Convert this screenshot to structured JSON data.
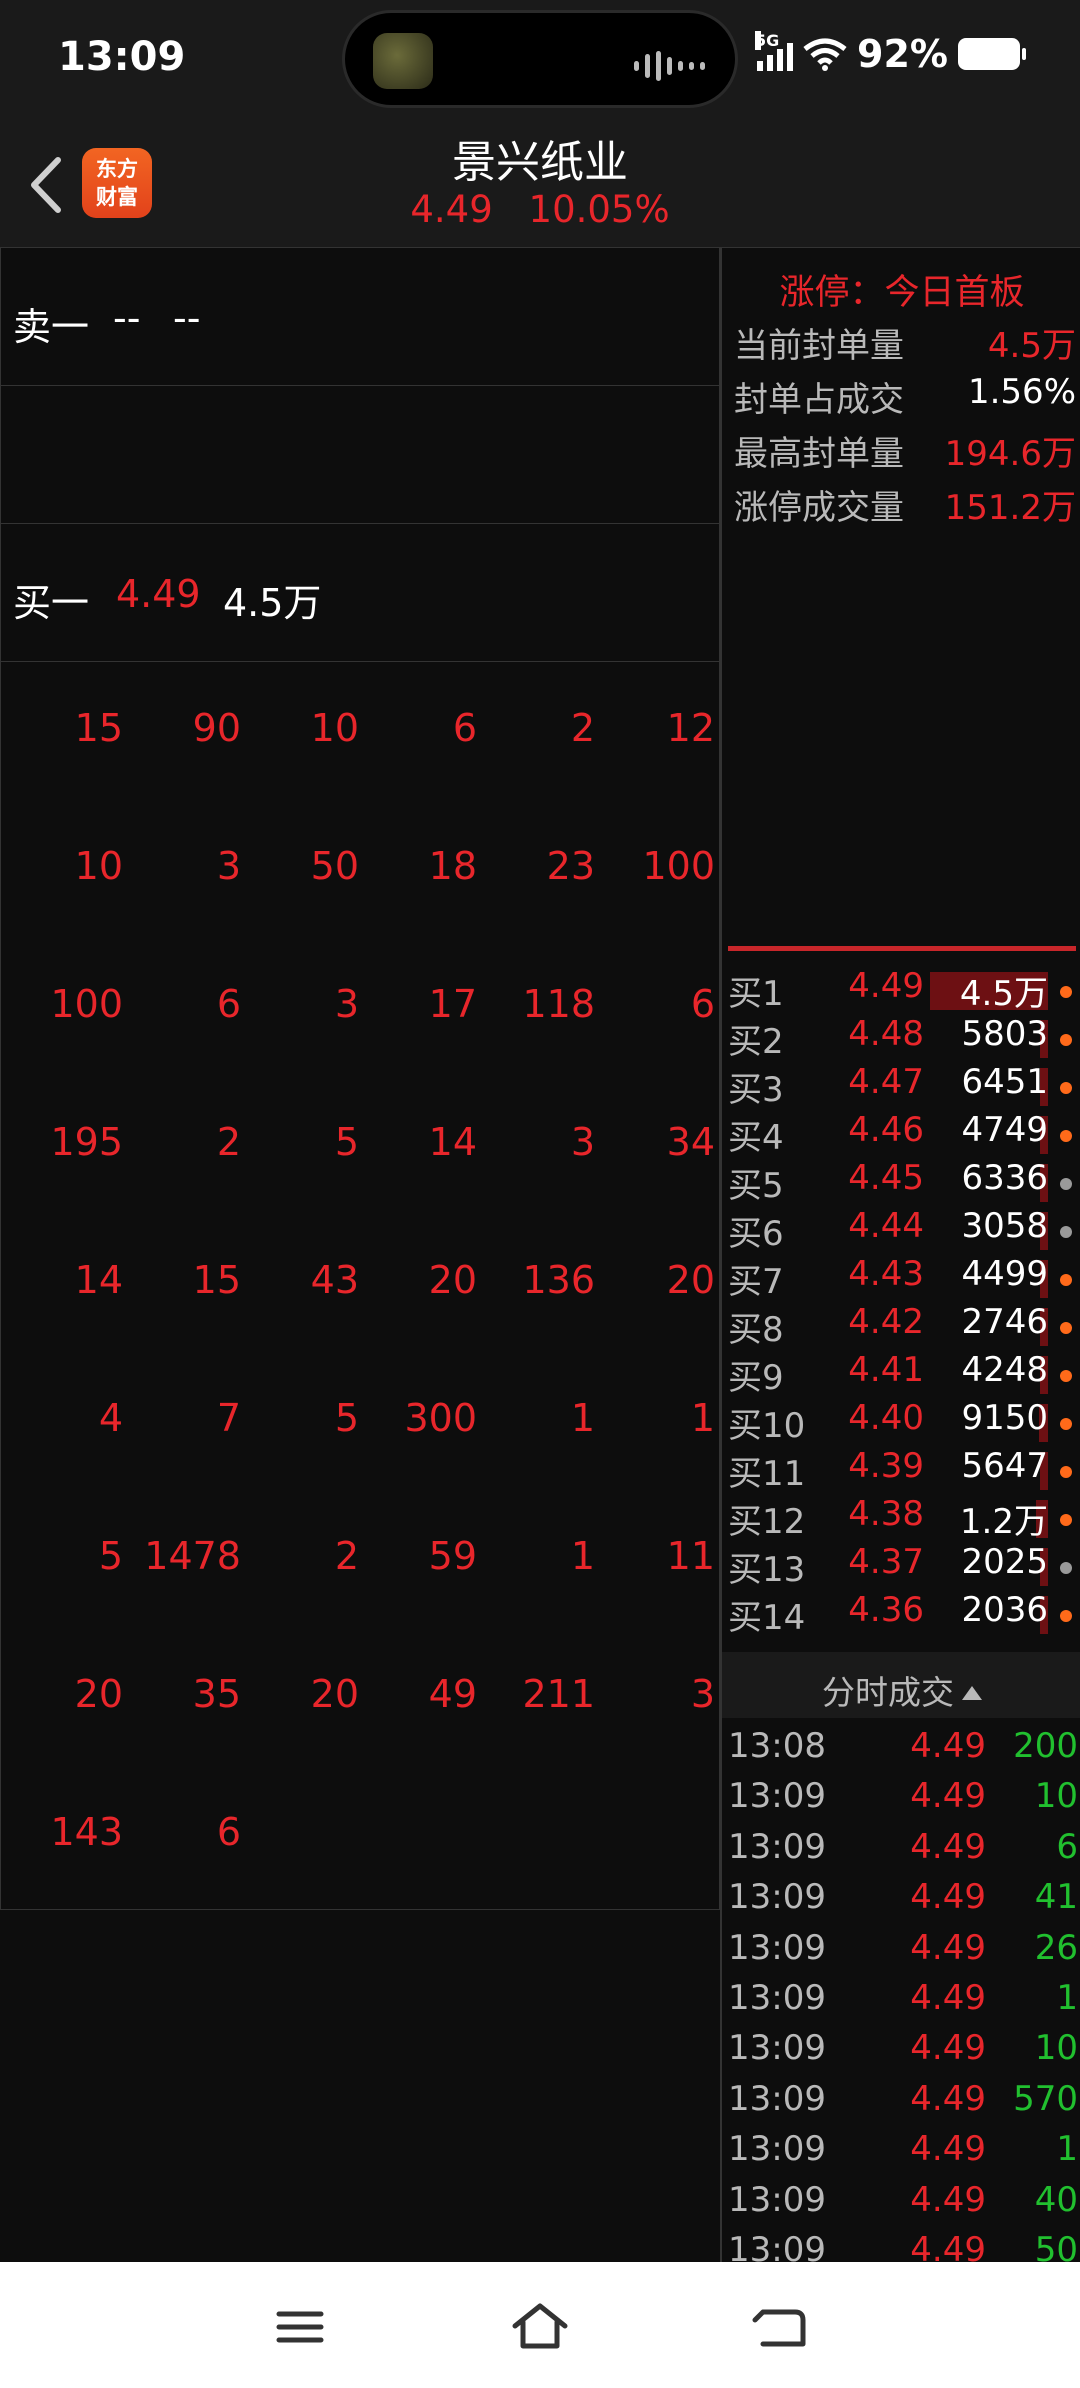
{
  "status_bar": {
    "time": "13:09",
    "network": "5G",
    "battery": "92%"
  },
  "header": {
    "stock_name": "景兴纸业",
    "price": "4.49",
    "change_pct": "10.05%",
    "logo_text_line1": "东方",
    "logo_text_line2": "财富"
  },
  "order_book": {
    "sell": {
      "label": "卖一",
      "price": "--",
      "volume": "--"
    },
    "buy": {
      "label": "买一",
      "price": "4.49",
      "volume": "4.5万"
    }
  },
  "order_grid": [
    [
      "15",
      "90",
      "10",
      "6",
      "2",
      "12"
    ],
    [
      "10",
      "3",
      "50",
      "18",
      "23",
      "100"
    ],
    [
      "100",
      "6",
      "3",
      "17",
      "118",
      "6"
    ],
    [
      "195",
      "2",
      "5",
      "14",
      "3",
      "34"
    ],
    [
      "14",
      "15",
      "43",
      "20",
      "136",
      "20"
    ],
    [
      "4",
      "7",
      "5",
      "300",
      "1",
      "1"
    ],
    [
      "5",
      "1478",
      "2",
      "59",
      "1",
      "11"
    ],
    [
      "20",
      "35",
      "20",
      "49",
      "211",
      "3"
    ],
    [
      "143",
      "6"
    ]
  ],
  "limit_info": {
    "title": "涨停：今日首板",
    "stats": [
      {
        "label": "当前封单量",
        "value": "4.5万",
        "color": "#e8262b"
      },
      {
        "label": "封单占成交",
        "value": "1.56%",
        "color": "#ffffff"
      },
      {
        "label": "最高封单量",
        "value": "194.6万",
        "color": "#e8262b"
      },
      {
        "label": "涨停成交量",
        "value": "151.2万",
        "color": "#e8262b"
      }
    ]
  },
  "buy_queue": [
    {
      "label": "买1",
      "price": "4.49",
      "volume": "4.5万",
      "bar": 1.0,
      "dot": "orange"
    },
    {
      "label": "买2",
      "price": "4.48",
      "volume": "5803",
      "bar": 0.05,
      "dot": "orange"
    },
    {
      "label": "买3",
      "price": "4.47",
      "volume": "6451",
      "bar": 0.06,
      "dot": "orange"
    },
    {
      "label": "买4",
      "price": "4.46",
      "volume": "4749",
      "bar": 0.04,
      "dot": "orange"
    },
    {
      "label": "买5",
      "price": "4.45",
      "volume": "6336",
      "bar": 0.06,
      "dot": "gray"
    },
    {
      "label": "买6",
      "price": "4.44",
      "volume": "3058",
      "bar": 0.03,
      "dot": "gray"
    },
    {
      "label": "买7",
      "price": "4.43",
      "volume": "4499",
      "bar": 0.04,
      "dot": "orange"
    },
    {
      "label": "买8",
      "price": "4.42",
      "volume": "2746",
      "bar": 0.03,
      "dot": "orange"
    },
    {
      "label": "买9",
      "price": "4.41",
      "volume": "4248",
      "bar": 0.04,
      "dot": "orange"
    },
    {
      "label": "买10",
      "price": "4.40",
      "volume": "9150",
      "bar": 0.08,
      "dot": "orange"
    },
    {
      "label": "买11",
      "price": "4.39",
      "volume": "5647",
      "bar": 0.05,
      "dot": "orange"
    },
    {
      "label": "买12",
      "price": "4.38",
      "volume": "1.2万",
      "bar": 0.1,
      "dot": "orange"
    },
    {
      "label": "买13",
      "price": "4.37",
      "volume": "2025",
      "bar": 0.02,
      "dot": "gray"
    },
    {
      "label": "买14",
      "price": "4.36",
      "volume": "2036",
      "bar": 0.02,
      "dot": "orange"
    }
  ],
  "ticks": {
    "header": "分时成交",
    "rows": [
      {
        "time": "13:08",
        "price": "4.49",
        "volume": "200"
      },
      {
        "time": "13:09",
        "price": "4.49",
        "volume": "10"
      },
      {
        "time": "13:09",
        "price": "4.49",
        "volume": "6"
      },
      {
        "time": "13:09",
        "price": "4.49",
        "volume": "41"
      },
      {
        "time": "13:09",
        "price": "4.49",
        "volume": "26"
      },
      {
        "time": "13:09",
        "price": "4.49",
        "volume": "1"
      },
      {
        "time": "13:09",
        "price": "4.49",
        "volume": "10"
      },
      {
        "time": "13:09",
        "price": "4.49",
        "volume": "570"
      },
      {
        "time": "13:09",
        "price": "4.49",
        "volume": "1"
      },
      {
        "time": "13:09",
        "price": "4.49",
        "volume": "40"
      },
      {
        "time": "13:09",
        "price": "4.49",
        "volume": "50"
      }
    ]
  },
  "colors": {
    "up": "#e8262b",
    "down": "#21c02f",
    "brand": "#f26522",
    "dot_orange": "#ff6a1a",
    "dot_gray": "#9a9a9a"
  }
}
